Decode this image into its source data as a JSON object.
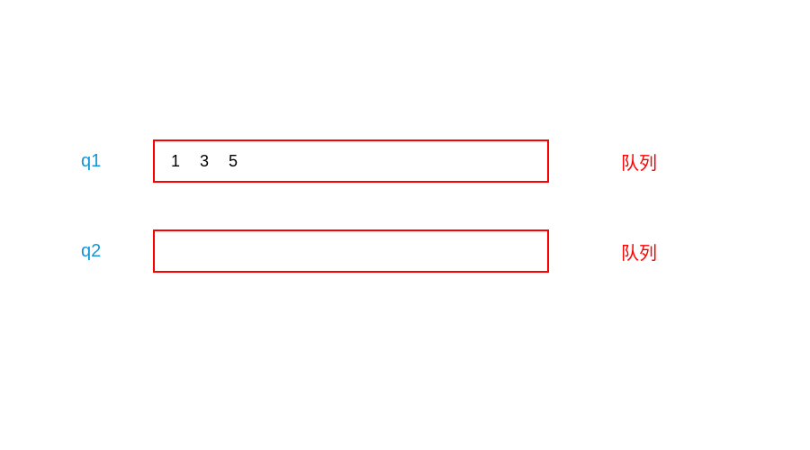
{
  "queues": [
    {
      "label": "q1",
      "items": [
        "1",
        "3",
        "5"
      ],
      "type_label": "队列"
    },
    {
      "label": "q2",
      "items": [],
      "type_label": "队列"
    }
  ]
}
